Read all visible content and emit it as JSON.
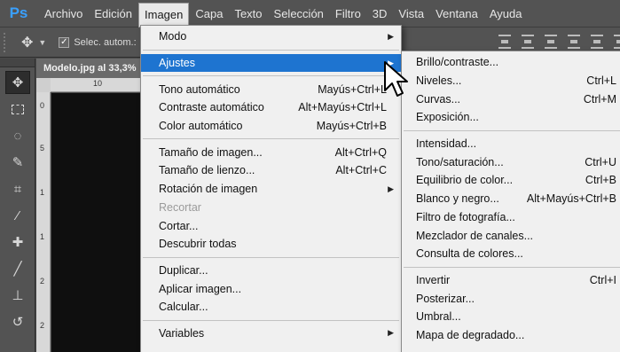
{
  "app": {
    "logo": "Ps"
  },
  "menubar": [
    "Archivo",
    "Edición",
    "Imagen",
    "Capa",
    "Texto",
    "Selección",
    "Filtro",
    "3D",
    "Vista",
    "Ventana",
    "Ayuda"
  ],
  "optionsbar": {
    "auto_select_label": "Selec. autom.:"
  },
  "document": {
    "tab_title": "Modelo.jpg al 33,3%",
    "ruler_h_mark": "10",
    "ruler_v_marks": [
      "0",
      "5",
      "1",
      "1",
      "2",
      "2"
    ]
  },
  "imagen_menu": {
    "items": [
      {
        "label": "Modo",
        "shortcut": "",
        "submenu": true
      },
      {
        "sep": true
      },
      {
        "label": "Ajustes",
        "shortcut": "",
        "submenu": true,
        "highlighted": true
      },
      {
        "sep": true
      },
      {
        "label": "Tono automático",
        "shortcut": "Mayús+Ctrl+L"
      },
      {
        "label": "Contraste automático",
        "shortcut": "Alt+Mayús+Ctrl+L"
      },
      {
        "label": "Color automático",
        "shortcut": "Mayús+Ctrl+B"
      },
      {
        "sep": true
      },
      {
        "label": "Tamaño de imagen...",
        "shortcut": "Alt+Ctrl+Q"
      },
      {
        "label": "Tamaño de lienzo...",
        "shortcut": "Alt+Ctrl+C"
      },
      {
        "label": "Rotación de imagen",
        "shortcut": "",
        "submenu": true
      },
      {
        "label": "Recortar",
        "shortcut": "",
        "disabled": true
      },
      {
        "label": "Cortar...",
        "shortcut": ""
      },
      {
        "label": "Descubrir todas",
        "shortcut": ""
      },
      {
        "sep": true
      },
      {
        "label": "Duplicar...",
        "shortcut": ""
      },
      {
        "label": "Aplicar imagen...",
        "shortcut": ""
      },
      {
        "label": "Calcular...",
        "shortcut": ""
      },
      {
        "sep": true
      },
      {
        "label": "Variables",
        "shortcut": "",
        "submenu": true
      }
    ]
  },
  "ajustes_menu": {
    "items": [
      {
        "label": "Brillo/contraste...",
        "shortcut": ""
      },
      {
        "label": "Niveles...",
        "shortcut": "Ctrl+L"
      },
      {
        "label": "Curvas...",
        "shortcut": "Ctrl+M"
      },
      {
        "label": "Exposición...",
        "shortcut": ""
      },
      {
        "sep": true
      },
      {
        "label": "Intensidad...",
        "shortcut": ""
      },
      {
        "label": "Tono/saturación...",
        "shortcut": "Ctrl+U"
      },
      {
        "label": "Equilibrio de color...",
        "shortcut": "Ctrl+B"
      },
      {
        "label": "Blanco y negro...",
        "shortcut": "Alt+Mayús+Ctrl+B"
      },
      {
        "label": "Filtro de fotografía...",
        "shortcut": ""
      },
      {
        "label": "Mezclador de canales...",
        "shortcut": ""
      },
      {
        "label": "Consulta de colores...",
        "shortcut": ""
      },
      {
        "sep": true
      },
      {
        "label": "Invertir",
        "shortcut": "Ctrl+I"
      },
      {
        "label": "Posterizar...",
        "shortcut": ""
      },
      {
        "label": "Umbral...",
        "shortcut": ""
      },
      {
        "label": "Mapa de degradado...",
        "shortcut": ""
      }
    ]
  },
  "tools": [
    "move-tool-icon",
    "marquee-tool-icon",
    "lasso-tool-icon",
    "quick-select-tool-icon",
    "crop-tool-icon",
    "eyedropper-tool-icon",
    "healing-brush-tool-icon",
    "brush-tool-icon",
    "clone-stamp-tool-icon",
    "history-brush-tool-icon"
  ],
  "colors": {
    "accent": "#1e74d0",
    "ps_blue": "#3aa0ff",
    "chrome": "#535353"
  }
}
